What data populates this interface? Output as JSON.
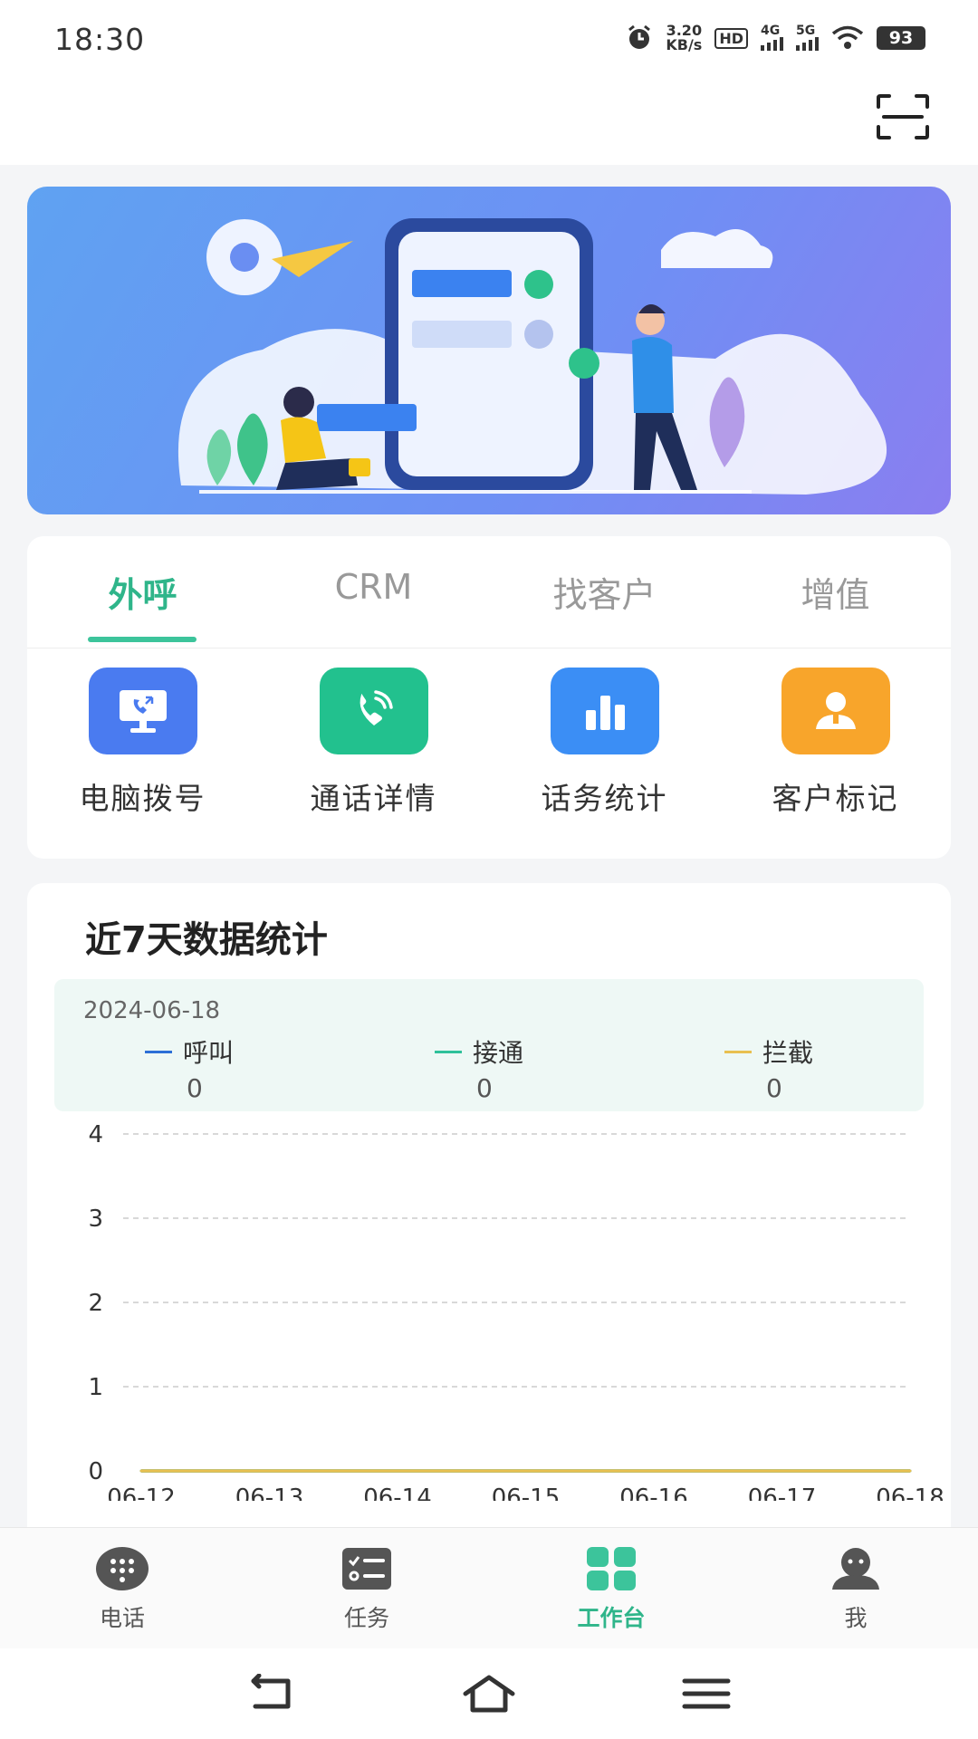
{
  "status_bar": {
    "time": "18:30",
    "net_speed_value": "3.20",
    "net_speed_unit": "KB/s",
    "hd_label": "HD",
    "signal_1": "4G",
    "signal_2": "5G",
    "battery": "93"
  },
  "header": {
    "scan_icon": "scan-icon"
  },
  "tabs": {
    "items": [
      {
        "label": "外呼",
        "active": true
      },
      {
        "label": "CRM",
        "active": false
      },
      {
        "label": "找客户",
        "active": false
      },
      {
        "label": "增值",
        "active": false
      }
    ]
  },
  "functions": [
    {
      "label": "电脑拨号",
      "icon": "computer-dial-icon",
      "color": "#4a7bf0"
    },
    {
      "label": "通话详情",
      "icon": "phone-call-icon",
      "color": "#22c18e"
    },
    {
      "label": "话务统计",
      "icon": "bar-chart-icon",
      "color": "#3b8ef5"
    },
    {
      "label": "客户标记",
      "icon": "customer-mark-icon",
      "color": "#f8a52b"
    }
  ],
  "stats": {
    "title": "近7天数据统计",
    "summary": {
      "date": "2024-06-18",
      "items": [
        {
          "name": "呼叫",
          "value": "0",
          "color": "#2c6fd6"
        },
        {
          "name": "接通",
          "value": "0",
          "color": "#2fc19a"
        },
        {
          "name": "拦截",
          "value": "0",
          "color": "#e8c050"
        }
      ]
    }
  },
  "chart_data": {
    "type": "line",
    "title": "",
    "x": [
      "06-12",
      "06-13",
      "06-14",
      "06-15",
      "06-16",
      "06-17",
      "06-18"
    ],
    "y_ticks": [
      "0",
      "1",
      "2",
      "3",
      "4"
    ],
    "ylim": [
      0,
      4
    ],
    "grid": true,
    "series": [
      {
        "name": "呼叫",
        "values": [
          0,
          0,
          0,
          0,
          0,
          0,
          0
        ],
        "color": "#2c6fd6"
      },
      {
        "name": "接通",
        "values": [
          0,
          0,
          0,
          0,
          0,
          0,
          0
        ],
        "color": "#2fc19a"
      },
      {
        "name": "拦截",
        "values": [
          0,
          0,
          0,
          0,
          0,
          0,
          0
        ],
        "color": "#e8c050"
      }
    ]
  },
  "tabbar": {
    "items": [
      {
        "label": "电话",
        "icon": "dialpad-icon",
        "active": false
      },
      {
        "label": "任务",
        "icon": "task-list-icon",
        "active": false
      },
      {
        "label": "工作台",
        "icon": "workbench-icon",
        "active": true
      },
      {
        "label": "我",
        "icon": "profile-icon",
        "active": false
      }
    ]
  },
  "nav": {
    "back": "back-icon",
    "home": "home-icon",
    "menu": "menu-icon"
  }
}
